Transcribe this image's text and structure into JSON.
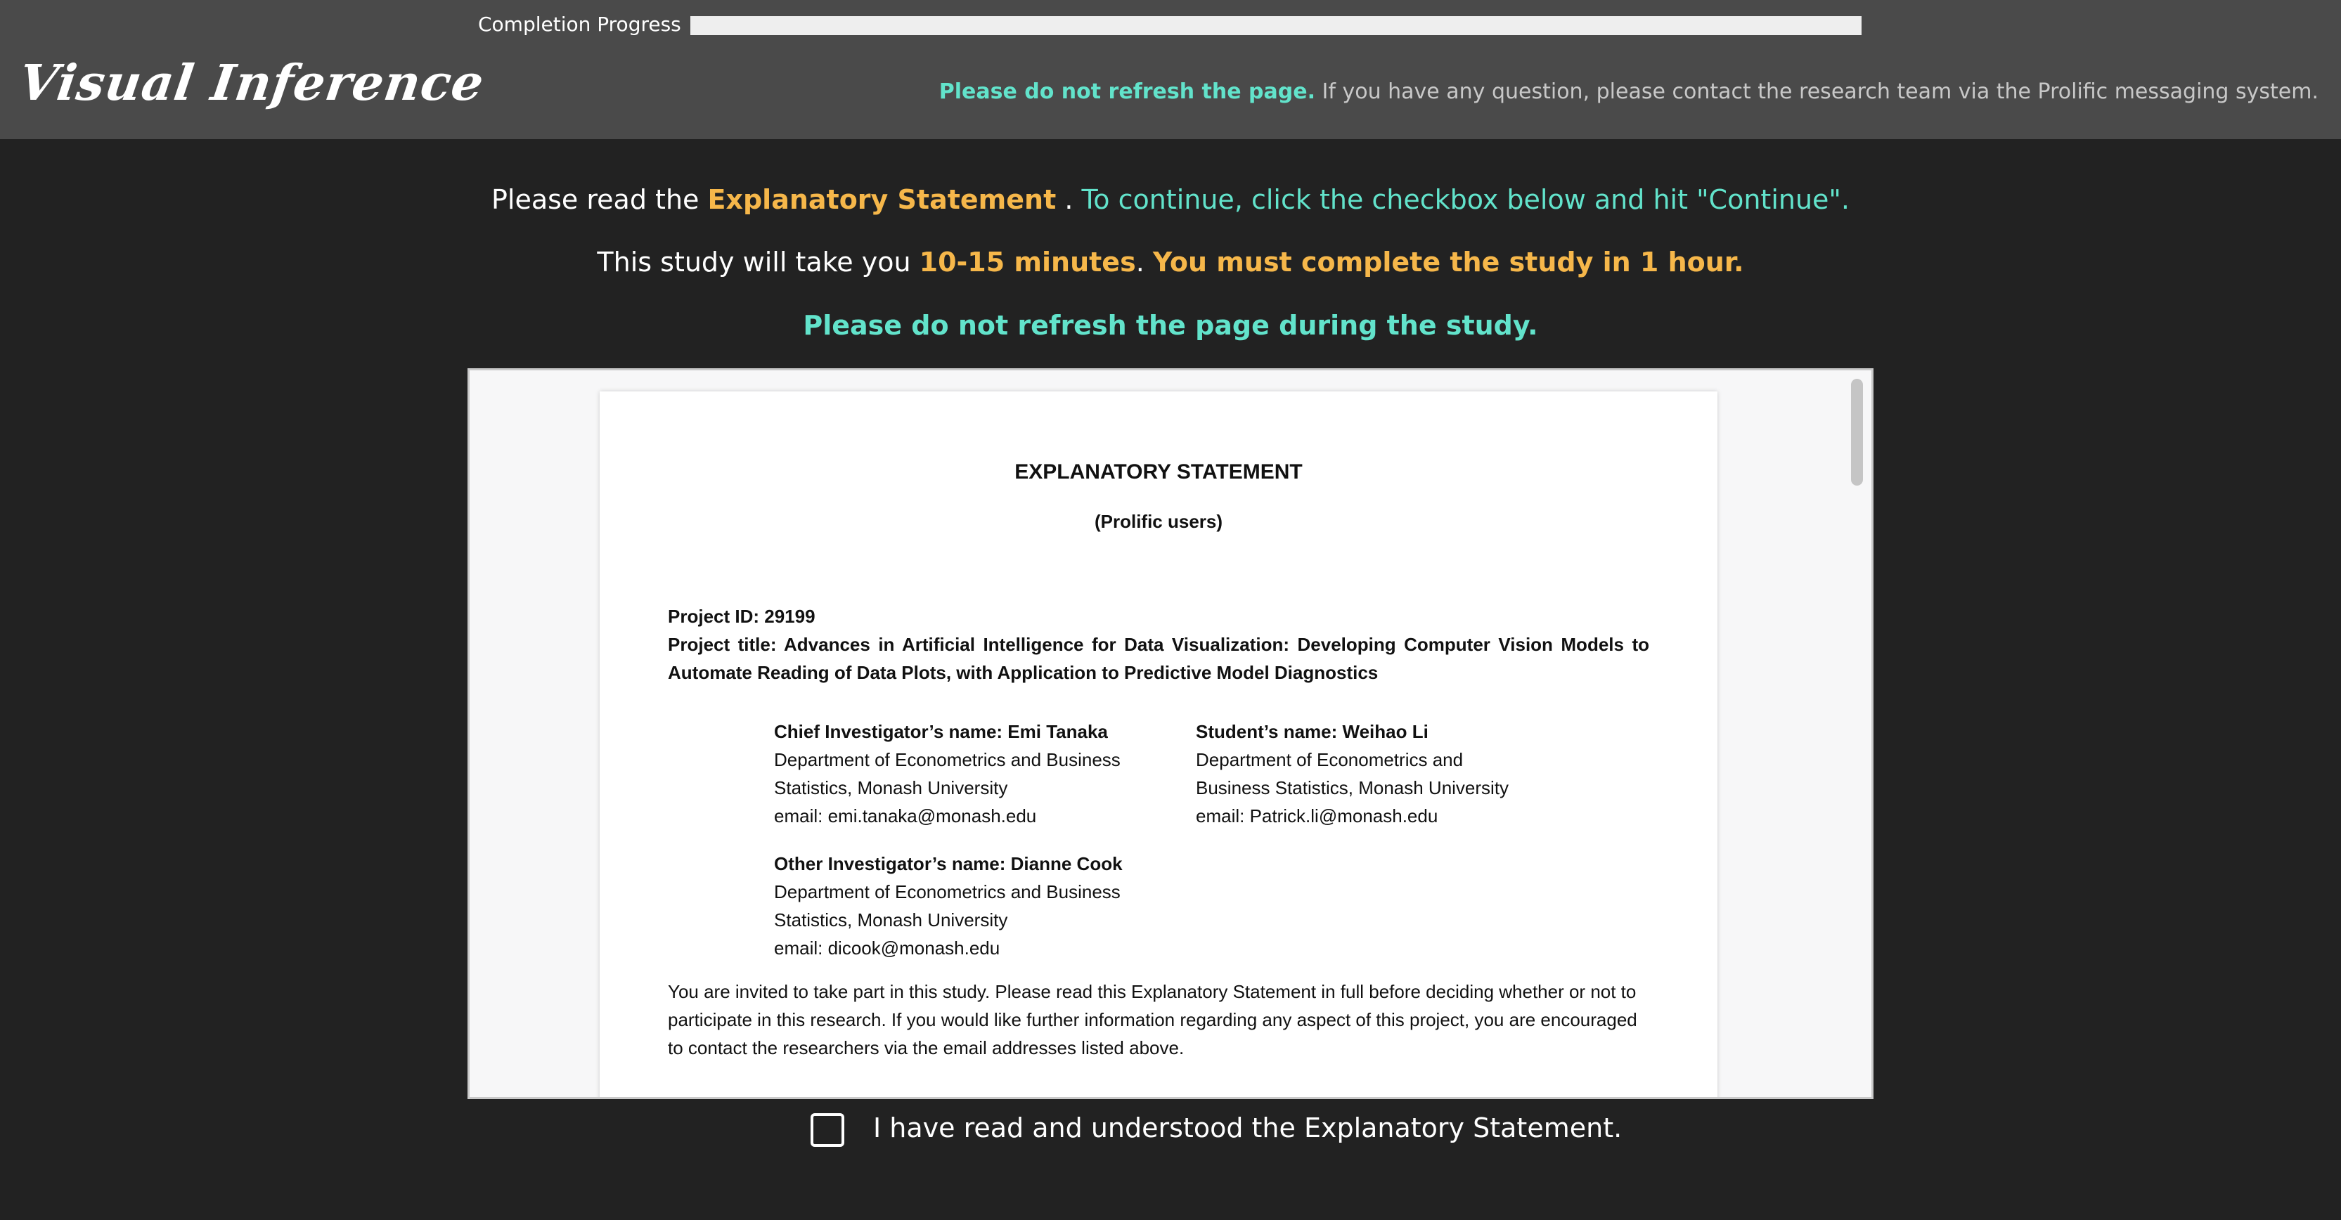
{
  "header": {
    "progress_label": "Completion Progress",
    "progress_fraction": 0,
    "logo_text": "Visual Inference",
    "notice_strong": "Please do not refresh the page.",
    "notice_rest": " If you have any question, please contact the research team via the Prolific messaging system."
  },
  "instructions": {
    "line1_prefix": "Please read the ",
    "line1_link": "Explanatory Statement",
    "line1_suffix": " . ",
    "line1_action": "To continue, click the checkbox below and hit \"Continue\".",
    "line2_prefix": "This study will take you ",
    "line2_duration": "10-15 minutes",
    "line2_sep": ". ",
    "line2_deadline": "You must complete the study in 1 hour.",
    "line3": "Please do not refresh the page during the study."
  },
  "document": {
    "title": "EXPLANATORY STATEMENT",
    "subtitle": "(Prolific users)",
    "project_id": "Project ID: 29199",
    "project_title": "Project title: Advances in Artificial Intelligence for Data Visualization: Developing Computer Vision Models to Automate Reading of Data Plots, with Application to Predictive Model Diagnostics",
    "chief": {
      "name": "Chief Investigator’s name: Emi Tanaka",
      "dept1": "Department of Econometrics and Business",
      "dept2": "Statistics, Monash University",
      "email": "email: emi.tanaka@monash.edu"
    },
    "student": {
      "name": "Student’s name: Weihao Li",
      "dept1": "Department of Econometrics and",
      "dept2": "Business Statistics, Monash University",
      "email": "email: Patrick.li@monash.edu"
    },
    "other": {
      "name": "Other Investigator’s name: Dianne Cook",
      "dept1": "Department of Econometrics and Business",
      "dept2": "Statistics, Monash University",
      "email": "email: dicook@monash.edu"
    },
    "invite": "You are invited to take part in this study.  Please read this Explanatory Statement in full before deciding whether or not to participate in this research. If you would like further information regarding any aspect of this project, you are encouraged to contact the researchers via the email addresses listed above."
  },
  "consent": {
    "checked": false,
    "label": "I have read and understood the Explanatory Statement."
  },
  "colors": {
    "accent_teal": "#62e3cb",
    "accent_gold": "#f6b74a",
    "background": "#222222",
    "header": "#4a4a4a"
  }
}
